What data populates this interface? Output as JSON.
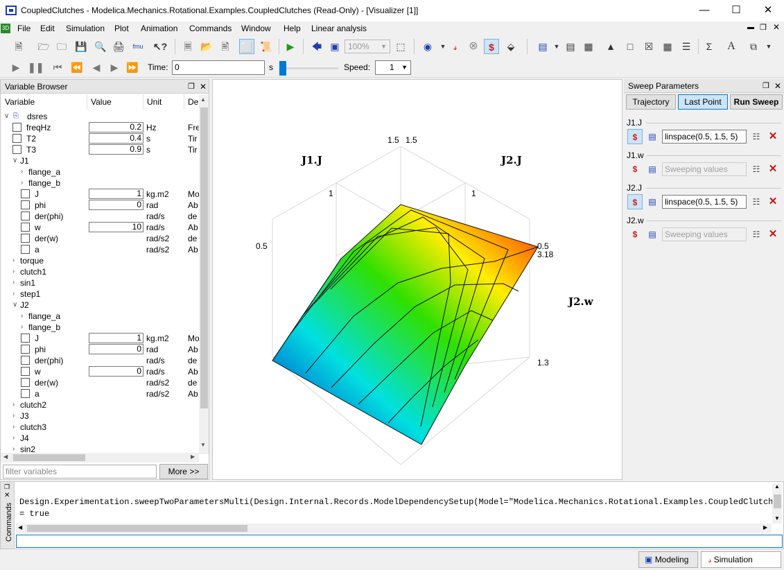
{
  "window": {
    "title": "CoupledClutches - Modelica.Mechanics.Rotational.Examples.CoupledClutches  (Read-Only) - [Visualizer [1]]"
  },
  "menu": [
    "File",
    "Edit",
    "Simulation",
    "Plot",
    "Animation",
    "Commands",
    "Window",
    "Help",
    "Linear analysis"
  ],
  "toolbar": {
    "zoom": "100%"
  },
  "animation": {
    "time_label": "Time:",
    "time_value": "0",
    "time_unit": "s",
    "speed_label": "Speed:",
    "speed_value": "1"
  },
  "variable_browser": {
    "title": "Variable Browser",
    "columns": [
      "Variable",
      "Value",
      "Unit",
      "De"
    ],
    "rows": [
      {
        "name": "dsres",
        "level": 0,
        "expander": "open",
        "checkbox": false,
        "value": "",
        "unit": "",
        "desc": ""
      },
      {
        "name": "freqHz",
        "level": 1,
        "expander": "",
        "checkbox": true,
        "value": "0.2",
        "unit": "Hz",
        "desc": "Fre"
      },
      {
        "name": "T2",
        "level": 1,
        "expander": "",
        "checkbox": true,
        "value": "0.4",
        "unit": "s",
        "desc": "Tir"
      },
      {
        "name": "T3",
        "level": 1,
        "expander": "",
        "checkbox": true,
        "value": "0.9",
        "unit": "s",
        "desc": "Tir"
      },
      {
        "name": "J1",
        "level": 1,
        "expander": "open",
        "checkbox": false,
        "value": "",
        "unit": "",
        "desc": ""
      },
      {
        "name": "flange_a",
        "level": 2,
        "expander": "closed",
        "checkbox": false,
        "value": "",
        "unit": "",
        "desc": ""
      },
      {
        "name": "flange_b",
        "level": 2,
        "expander": "closed",
        "checkbox": false,
        "value": "",
        "unit": "",
        "desc": ""
      },
      {
        "name": "J",
        "level": 2,
        "expander": "",
        "checkbox": true,
        "value": "1",
        "unit": "kg.m2",
        "desc": "Mo"
      },
      {
        "name": "phi",
        "level": 2,
        "expander": "",
        "checkbox": true,
        "value": "0",
        "unit": "rad",
        "desc": "Ab"
      },
      {
        "name": "der(phi)",
        "level": 2,
        "expander": "",
        "checkbox": true,
        "value": "",
        "unit": "rad/s",
        "desc": "de"
      },
      {
        "name": "w",
        "level": 2,
        "expander": "",
        "checkbox": true,
        "value": "10",
        "unit": "rad/s",
        "desc": "Ab"
      },
      {
        "name": "der(w)",
        "level": 2,
        "expander": "",
        "checkbox": true,
        "value": "",
        "unit": "rad/s2",
        "desc": "de"
      },
      {
        "name": "a",
        "level": 2,
        "expander": "",
        "checkbox": true,
        "value": "",
        "unit": "rad/s2",
        "desc": "Ab"
      },
      {
        "name": "torque",
        "level": 1,
        "expander": "closed",
        "checkbox": false,
        "value": "",
        "unit": "",
        "desc": ""
      },
      {
        "name": "clutch1",
        "level": 1,
        "expander": "closed",
        "checkbox": false,
        "value": "",
        "unit": "",
        "desc": ""
      },
      {
        "name": "sin1",
        "level": 1,
        "expander": "closed",
        "checkbox": false,
        "value": "",
        "unit": "",
        "desc": ""
      },
      {
        "name": "step1",
        "level": 1,
        "expander": "closed",
        "checkbox": false,
        "value": "",
        "unit": "",
        "desc": ""
      },
      {
        "name": "J2",
        "level": 1,
        "expander": "open",
        "checkbox": false,
        "value": "",
        "unit": "",
        "desc": ""
      },
      {
        "name": "flange_a",
        "level": 2,
        "expander": "closed",
        "checkbox": false,
        "value": "",
        "unit": "",
        "desc": ""
      },
      {
        "name": "flange_b",
        "level": 2,
        "expander": "closed",
        "checkbox": false,
        "value": "",
        "unit": "",
        "desc": ""
      },
      {
        "name": "J",
        "level": 2,
        "expander": "",
        "checkbox": true,
        "value": "1",
        "unit": "kg.m2",
        "desc": "Mo"
      },
      {
        "name": "phi",
        "level": 2,
        "expander": "",
        "checkbox": true,
        "value": "0",
        "unit": "rad",
        "desc": "Ab"
      },
      {
        "name": "der(phi)",
        "level": 2,
        "expander": "",
        "checkbox": true,
        "value": "",
        "unit": "rad/s",
        "desc": "de"
      },
      {
        "name": "w",
        "level": 2,
        "expander": "",
        "checkbox": true,
        "value": "0",
        "unit": "rad/s",
        "desc": "Ab"
      },
      {
        "name": "der(w)",
        "level": 2,
        "expander": "",
        "checkbox": true,
        "value": "",
        "unit": "rad/s2",
        "desc": "de"
      },
      {
        "name": "a",
        "level": 2,
        "expander": "",
        "checkbox": true,
        "value": "",
        "unit": "rad/s2",
        "desc": "Ab"
      },
      {
        "name": "clutch2",
        "level": 1,
        "expander": "closed",
        "checkbox": false,
        "value": "",
        "unit": "",
        "desc": ""
      },
      {
        "name": "J3",
        "level": 1,
        "expander": "closed",
        "checkbox": false,
        "value": "",
        "unit": "",
        "desc": ""
      },
      {
        "name": "clutch3",
        "level": 1,
        "expander": "closed",
        "checkbox": false,
        "value": "",
        "unit": "",
        "desc": ""
      },
      {
        "name": "J4",
        "level": 1,
        "expander": "closed",
        "checkbox": false,
        "value": "",
        "unit": "",
        "desc": ""
      },
      {
        "name": "sin2",
        "level": 1,
        "expander": "closed",
        "checkbox": false,
        "value": "",
        "unit": "",
        "desc": ""
      }
    ],
    "filter_placeholder": "filter variables",
    "more_label": "More >>"
  },
  "plot": {
    "axis_labels": {
      "j1": "J1.J",
      "j2": "J2.J",
      "z": "J2.w"
    },
    "tick_labels": {
      "j1_max": "1.5",
      "j2_max": "1.5",
      "j1_mid": "1",
      "j2_mid": "1",
      "j1_min": "0.5",
      "j2_min": "0.5",
      "z_max": "3.18",
      "z_min": "1.3"
    },
    "colors": {
      "low": "#0000c8",
      "mid": "#ffff00",
      "high": "#ff0000"
    }
  },
  "chart_data": {
    "type": "surface",
    "x": [
      0.5,
      0.75,
      1.0,
      1.25,
      1.5
    ],
    "y": [
      0.5,
      0.75,
      1.0,
      1.25,
      1.5
    ],
    "z": [
      [
        3.18,
        2.9,
        2.62,
        2.35,
        2.1
      ],
      [
        2.95,
        2.68,
        2.42,
        2.18,
        1.95
      ],
      [
        2.75,
        2.48,
        2.25,
        2.02,
        1.8
      ],
      [
        2.58,
        2.32,
        2.1,
        1.88,
        1.65
      ],
      [
        2.42,
        2.18,
        1.97,
        1.75,
        1.3
      ]
    ],
    "zlim": [
      1.3,
      3.18
    ],
    "colormap": "jet"
  },
  "sweep": {
    "title": "Sweep Parameters",
    "tabs": [
      "Trajectory",
      "Last Point"
    ],
    "run_label": "Run Sweep",
    "params": [
      {
        "name": "J1.J",
        "value": "linspace(0.5, 1.5, 5)",
        "active": true
      },
      {
        "name": "J1.w",
        "value": "Sweeping values",
        "active": false
      },
      {
        "name": "J2.J",
        "value": "linspace(0.5, 1.5, 5)",
        "active": true
      },
      {
        "name": "J2.w",
        "value": "Sweeping values",
        "active": false
      }
    ]
  },
  "commands": {
    "title": "Commands",
    "line1": "Design.Experimentation.sweepTwoParametersMulti(Design.Internal.Records.ModelDependencySetup(Model=\"Modelica.Mechanics.Rotational.Examples.CoupledClutches\",",
    "line2": " = true"
  },
  "statusbar": {
    "modeling": "Modeling",
    "simulation": "Simulation"
  }
}
